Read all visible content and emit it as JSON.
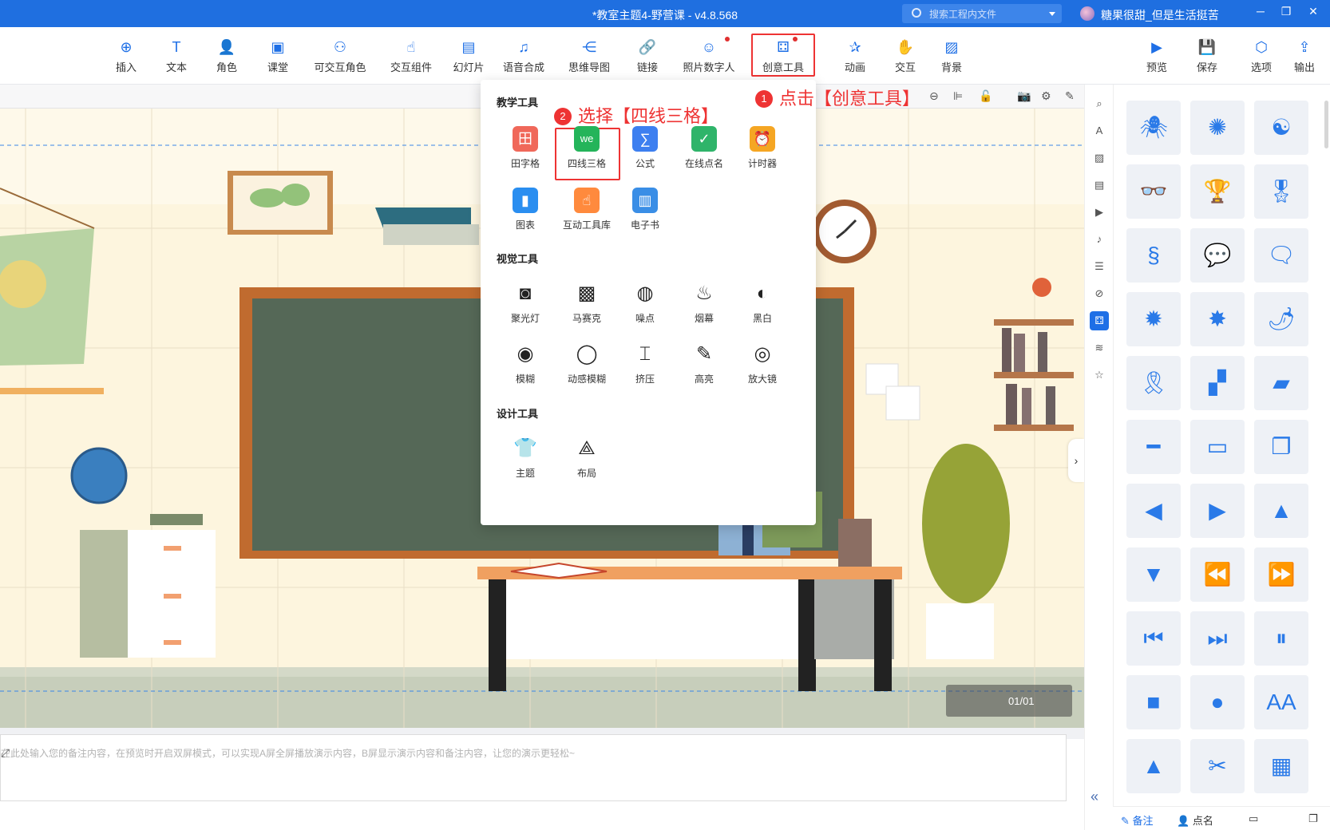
{
  "titlebar": {
    "title": "*教室主题4-野营课 - v4.8.568",
    "search_placeholder": "搜索工程内文件",
    "username": "糖果很甜_但是生活挺苦",
    "controls": [
      "─",
      "❐",
      "✕"
    ]
  },
  "toolbar": {
    "items": [
      {
        "label": "插入",
        "icon": "plus-circle-icon",
        "glyph": "⊕"
      },
      {
        "label": "文本",
        "icon": "text-icon",
        "glyph": "T"
      },
      {
        "label": "角色",
        "icon": "person-icon",
        "glyph": "👤"
      },
      {
        "label": "课堂",
        "icon": "classroom-icon",
        "glyph": "▣"
      },
      {
        "label": "可交互角色",
        "icon": "interactive-person-icon",
        "glyph": "⚇"
      },
      {
        "label": "交互组件",
        "icon": "tap-hand-icon",
        "glyph": "☝"
      },
      {
        "label": "幻灯片",
        "icon": "slide-icon",
        "glyph": "▤"
      },
      {
        "label": "语音合成",
        "icon": "voice-icon",
        "glyph": "♫"
      },
      {
        "label": "思维导图",
        "icon": "mindmap-icon",
        "glyph": "⋲"
      },
      {
        "label": "链接",
        "icon": "link-icon",
        "glyph": "🔗"
      },
      {
        "label": "照片数字人",
        "icon": "photo-avatar-icon",
        "glyph": "☺"
      },
      {
        "label": "创意工具",
        "icon": "creative-tools-icon",
        "glyph": "⚃"
      },
      {
        "label": "动画",
        "icon": "star-anim-icon",
        "glyph": "✰"
      },
      {
        "label": "交互",
        "icon": "hand-icon",
        "glyph": "✋"
      },
      {
        "label": "背景",
        "icon": "background-icon",
        "glyph": "▨"
      }
    ],
    "right_items": [
      {
        "label": "预览",
        "icon": "preview-icon",
        "glyph": "▶"
      },
      {
        "label": "保存",
        "icon": "save-icon",
        "glyph": "💾"
      },
      {
        "label": "选项",
        "icon": "options-icon",
        "glyph": "⬡"
      },
      {
        "label": "输出",
        "icon": "export-icon",
        "glyph": "⇪"
      }
    ]
  },
  "annotations": {
    "step1_num": "1",
    "step1_text": "点击【创意工具】",
    "step2_num": "2",
    "step2_text": "选择【四线三格】"
  },
  "dropdown": {
    "sections": {
      "teaching": "教学工具",
      "visual": "视觉工具",
      "design": "设计工具"
    },
    "teaching_tools": [
      {
        "label": "田字格",
        "icon": "tianzige-icon",
        "glyph": "田",
        "color": "#f0685a"
      },
      {
        "label": "四线三格",
        "icon": "four-line-grid-icon",
        "glyph": "we",
        "color": "#24b45a"
      },
      {
        "label": "公式",
        "icon": "formula-icon",
        "glyph": "∑",
        "color": "#3d7ff0"
      },
      {
        "label": "在线点名",
        "icon": "roll-call-icon",
        "glyph": "✓",
        "color": "#2fb46a"
      },
      {
        "label": "计时器",
        "icon": "timer-icon",
        "glyph": "⏰",
        "color": "#f5a623"
      },
      {
        "label": "图表",
        "icon": "chart-icon",
        "glyph": "▮",
        "color": "#2a8ef0"
      },
      {
        "label": "互动工具库",
        "icon": "interactive-library-icon",
        "glyph": "☝",
        "color": "#ff8a3d"
      },
      {
        "label": "电子书",
        "icon": "ebook-icon",
        "glyph": "▥",
        "color": "#3a8ee6"
      }
    ],
    "visual_tools": [
      {
        "label": "聚光灯",
        "icon": "spotlight-icon",
        "glyph": "◙"
      },
      {
        "label": "马赛克",
        "icon": "mosaic-icon",
        "glyph": "▩"
      },
      {
        "label": "噪点",
        "icon": "noise-icon",
        "glyph": "◍"
      },
      {
        "label": "烟幕",
        "icon": "smoke-icon",
        "glyph": "♨"
      },
      {
        "label": "黑白",
        "icon": "black-white-icon",
        "glyph": "◐"
      },
      {
        "label": "模糊",
        "icon": "blur-icon",
        "glyph": "◉"
      },
      {
        "label": "动感模糊",
        "icon": "motion-blur-icon",
        "glyph": "◯"
      },
      {
        "label": "挤压",
        "icon": "squeeze-icon",
        "glyph": "⌶"
      },
      {
        "label": "高亮",
        "icon": "highlight-icon",
        "glyph": "✎"
      },
      {
        "label": "放大镜",
        "icon": "magnifier-icon",
        "glyph": "◎"
      }
    ],
    "design_tools": [
      {
        "label": "主题",
        "icon": "theme-shirt-icon",
        "glyph": "👕"
      },
      {
        "label": "布局",
        "icon": "layout-icon",
        "glyph": "⟁"
      }
    ]
  },
  "notes": {
    "placeholder": "在此处输入您的备注内容，在预览时开启双屏模式，可以实现A屏全屏播放演示内容，B屏显示演示内容和备注内容，让您的演示更轻松~"
  },
  "pager": {
    "text": "01/01"
  },
  "right_panel": {
    "icons": [
      "🕷",
      "✺",
      "☯",
      "👓",
      "🏆",
      "🎖",
      "§",
      "💬",
      "🗨",
      "✹",
      "✸",
      "🌶",
      "🎗",
      "▞",
      "▰",
      "━",
      "▭",
      "❐",
      "◀",
      "▶",
      "▲",
      "▼",
      "⏪",
      "⏩",
      "⏮",
      "⏭",
      "⏸",
      "■",
      "●",
      "AA",
      "▲",
      "✂",
      "▦"
    ]
  },
  "bottombar": {
    "notes": "备注",
    "rollcall": "点名"
  }
}
